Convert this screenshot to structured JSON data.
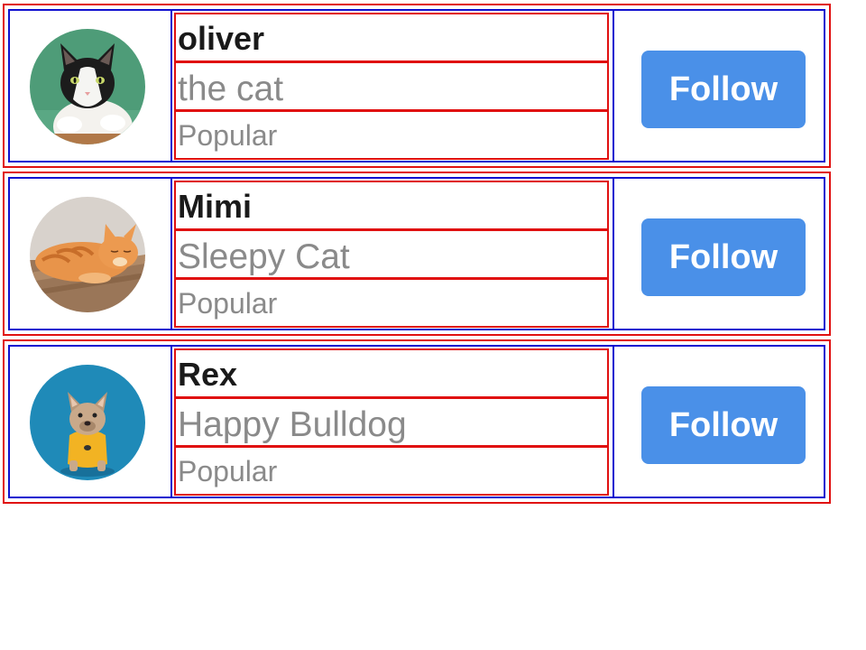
{
  "accounts": [
    {
      "name": "oliver",
      "description": "the cat",
      "tag": "Popular",
      "follow_label": "Follow",
      "avatar": "tuxedo-cat-photo"
    },
    {
      "name": "Mimi",
      "description": "Sleepy Cat",
      "tag": "Popular",
      "follow_label": "Follow",
      "avatar": "orange-tabby-cat-photo"
    },
    {
      "name": "Rex",
      "description": "Happy Bulldog",
      "tag": "Popular",
      "follow_label": "Follow",
      "avatar": "french-bulldog-photo"
    }
  ],
  "colors": {
    "follow_button": "#4a90e8",
    "outer_outline": "#e01010",
    "inner_outline": "#1010d0",
    "name_text": "#1a1a1a",
    "secondary_text": "#8a8a8a"
  }
}
